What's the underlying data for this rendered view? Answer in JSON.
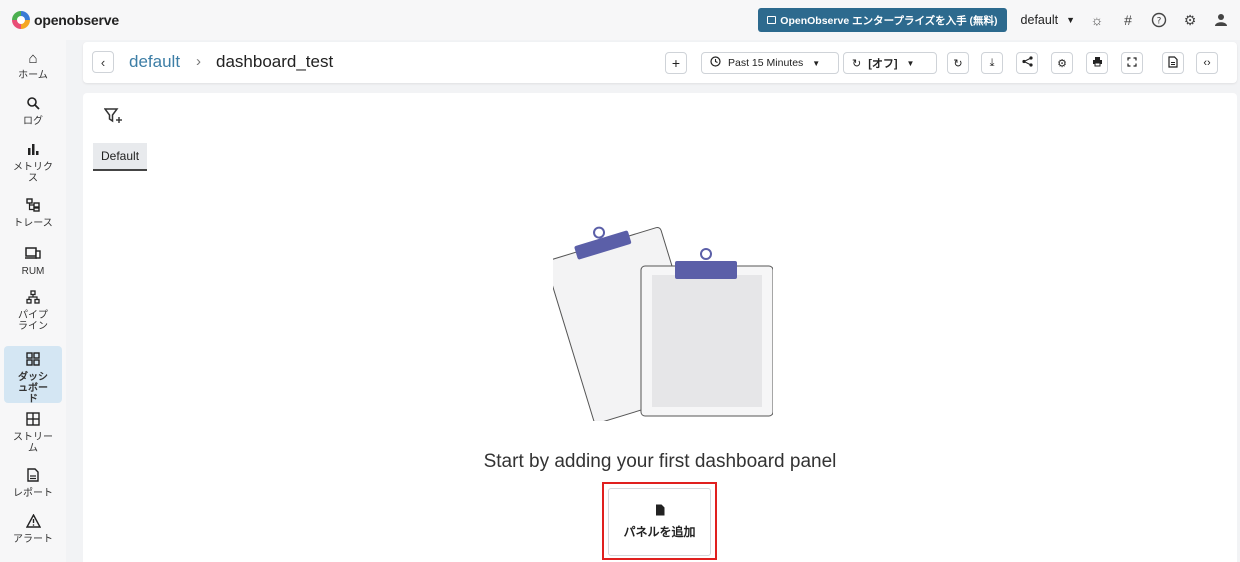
{
  "app": {
    "logo_text": "openobserve"
  },
  "topbar": {
    "enterprise_label": "OpenObserve エンタープライズを入手 (無料)",
    "org": "default",
    "icons": [
      "theme-sun-icon",
      "slack-icon",
      "help-icon",
      "settings-gear-icon",
      "user-icon"
    ]
  },
  "sidebar": {
    "items": [
      {
        "label": "ホーム",
        "icon": "⌂"
      },
      {
        "label": "ログ",
        "icon": "🔍︎"
      },
      {
        "label": "メトリクス",
        "icon": "▮"
      },
      {
        "label": "トレース",
        "icon": "⊞"
      },
      {
        "label": "RUM",
        "icon": "▭"
      },
      {
        "label": "パイプライン",
        "icon": "⧉"
      },
      {
        "label": "ダッシュボード",
        "icon": "▦"
      },
      {
        "label": "ストリーム",
        "icon": "⊞"
      },
      {
        "label": "レポート",
        "icon": "▤"
      },
      {
        "label": "アラート",
        "icon": "⚠"
      }
    ],
    "active_index": 6
  },
  "header": {
    "breadcrumb_org": "default",
    "breadcrumb_sep": "›",
    "dashboard_name": "dashboard_test",
    "add_icon": "+",
    "time_range": "Past 15 Minutes",
    "refresh_label": "[オフ]"
  },
  "content": {
    "tab_label": "Default",
    "empty_message": "Start by adding your first dashboard panel",
    "add_panel_label": "パネルを追加"
  },
  "colors": {
    "accent": "#3d7ea6",
    "enterprise_btn": "#2d6a8e",
    "clip": "#5b5fa8",
    "highlight": "#e0201f",
    "active_nav": "#d4e6f3"
  }
}
